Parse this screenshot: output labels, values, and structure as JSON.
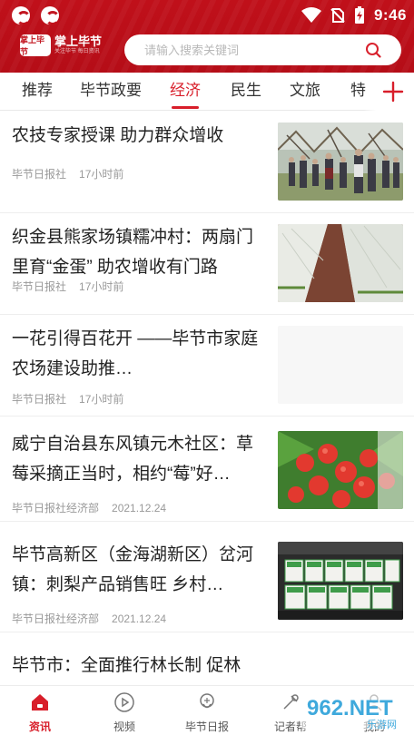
{
  "status": {
    "time": "9:46"
  },
  "app": {
    "logo_badge": "掌上毕节",
    "logo_title": "掌上毕节",
    "logo_sub": "关注毕节 每日资讯"
  },
  "search": {
    "placeholder": "请输入搜索关键词"
  },
  "tabs": [
    "推荐",
    "毕节政要",
    "经济",
    "民生",
    "文旅",
    "特"
  ],
  "active_tab": "经济",
  "news": [
    {
      "title": "农技专家授课 助力群众增收",
      "source": "毕节日报社",
      "time": "17小时前",
      "image": "orchard-training-photo"
    },
    {
      "title": "织金县熊家场镇糯冲村：两扇门里育“金蛋” 助农增收有门路",
      "source": "毕节日报社",
      "time": "17小时前",
      "image": "greenhouse-photo"
    },
    {
      "title": "一花引得百花开 ——毕节市家庭农场建设助推…",
      "source": "毕节日报社",
      "time": "17小时前",
      "image": ""
    },
    {
      "title": "威宁自治县东风镇元木社区：草莓采摘正当时，相约“莓”好…",
      "source": "毕节日报社经济部",
      "time": "2021.12.24",
      "image": "strawberry-photo"
    },
    {
      "title": "毕节高新区（金海湖新区）岔河镇：刺梨产品销售旺 乡村…",
      "source": "毕节日报社经济部",
      "time": "2021.12.24",
      "image": "product-boxes-photo"
    },
    {
      "title": "毕节市：全面推行林长制 促林",
      "source": "",
      "time": "",
      "image": ""
    }
  ],
  "bottom_nav": [
    {
      "label": "资讯",
      "icon": "home-icon",
      "active": true
    },
    {
      "label": "视频",
      "icon": "play-icon",
      "active": false
    },
    {
      "label": "毕节日报",
      "icon": "newspaper-icon",
      "active": false
    },
    {
      "label": "记者帮",
      "icon": "reporter-icon",
      "active": false
    },
    {
      "label": "我的",
      "icon": "user-icon",
      "active": false
    }
  ],
  "watermark": {
    "text": "962.NET",
    "sub": "乐游网"
  },
  "colors": {
    "brand_red": "#c0101a",
    "accent_red": "#d81e2a"
  }
}
